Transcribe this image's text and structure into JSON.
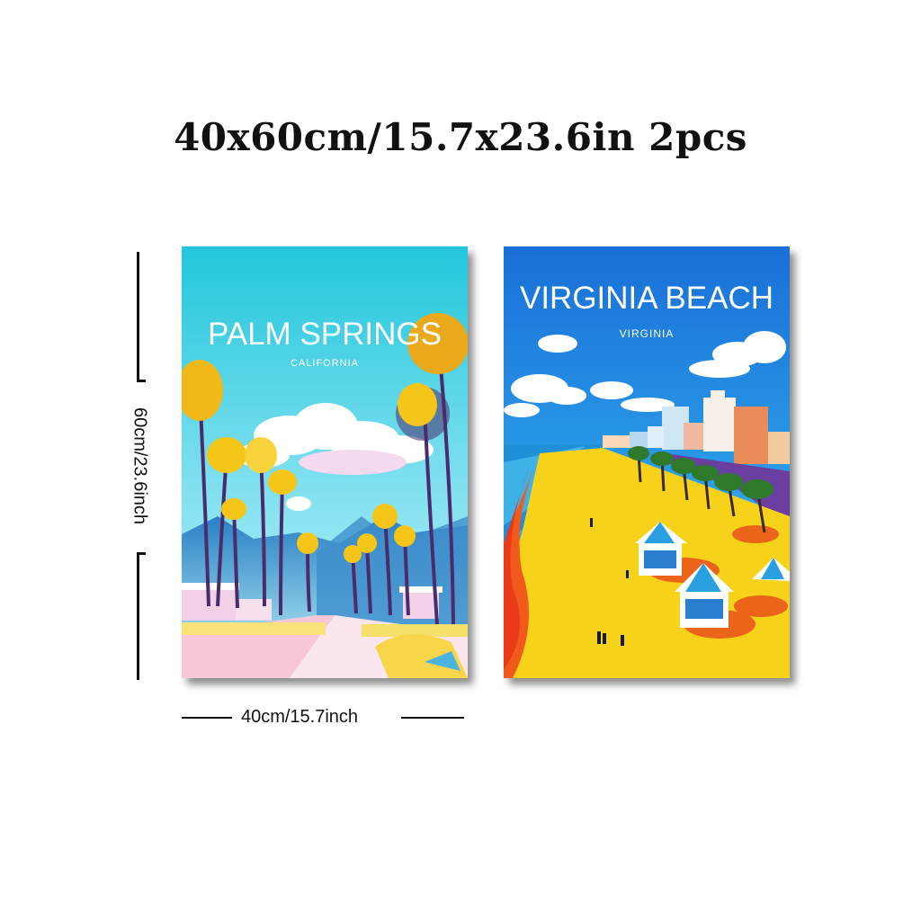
{
  "headline": "40x60cm/15.7x23.6in 2pcs",
  "dimensions": {
    "height_label": "60cm/23.6inch",
    "width_label": "40cm/15.7inch"
  },
  "posters": [
    {
      "title": "PALM SPRINGS",
      "subtitle": "CALIFORNIA"
    },
    {
      "title": "VIRGINIA BEACH",
      "subtitle": "VIRGINIA"
    }
  ],
  "colors": {
    "palm_sky": "#1fc8dc",
    "virginia_sky": "#1e7fe0",
    "sand": "#f7d21a",
    "road": "#f6c7d8"
  }
}
